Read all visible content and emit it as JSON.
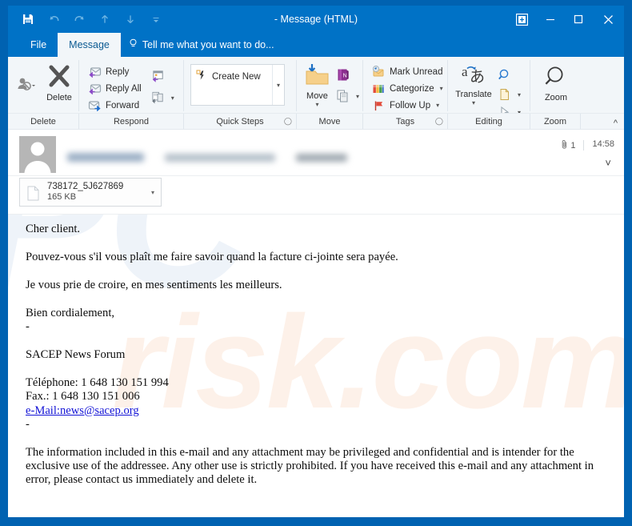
{
  "window": {
    "title": "- Message (HTML)",
    "quick_access": [
      {
        "name": "save-button",
        "label": "Save",
        "enabled": true
      },
      {
        "name": "undo-button",
        "label": "Undo",
        "enabled": false
      },
      {
        "name": "redo-button",
        "label": "Redo",
        "enabled": false
      },
      {
        "name": "previous-item-button",
        "label": "Previous Item",
        "enabled": false
      },
      {
        "name": "next-item-button",
        "label": "Next Item",
        "enabled": false
      },
      {
        "name": "customize-quick-access-toolbar-button",
        "label": "Customize Quick Access Toolbar",
        "enabled": false
      }
    ],
    "controls": {
      "ribbon_display_options": "Ribbon Display Options",
      "minimize": "Minimize",
      "maximize": "Maximize",
      "close": "Close"
    }
  },
  "tabs": {
    "file": "File",
    "message": "Message",
    "tellme": "Tell me what you want to do..."
  },
  "ribbon": {
    "groups": [
      {
        "label": "Delete",
        "launcher": false
      },
      {
        "label": "Respond",
        "launcher": false
      },
      {
        "label": "Quick Steps",
        "launcher": true
      },
      {
        "label": "Move",
        "launcher": false
      },
      {
        "label": "Tags",
        "launcher": true
      },
      {
        "label": "Editing",
        "launcher": false
      },
      {
        "label": "Zoom",
        "launcher": false
      }
    ],
    "delete": {
      "ignore": "Ignore",
      "delete": "Delete"
    },
    "respond": {
      "reply": "Reply",
      "reply_all": "Reply All",
      "forward": "Forward",
      "meeting": "Meeting",
      "more": "More"
    },
    "quick_steps": {
      "create_new": "Create New"
    },
    "move": {
      "move": "Move",
      "onenote": "OneNote",
      "actions": "Actions"
    },
    "tags": {
      "mark_unread": "Mark Unread",
      "categorize": "Categorize",
      "follow_up": "Follow Up"
    },
    "editing": {
      "translate": "Translate",
      "find": "Find",
      "select": "Select"
    },
    "zoom": {
      "zoom": "Zoom"
    },
    "collapse": "Collapse the Ribbon"
  },
  "message_header": {
    "sender_redacted": true,
    "attachment_count": "1",
    "time": "14:58"
  },
  "attachment": {
    "name": "738172_5J627869",
    "size": "165 KB"
  },
  "body": {
    "greeting": "Cher client.",
    "request": "Pouvez-vous s'il vous plaît me faire savoir quand la facture ci-jointe sera payée.",
    "closing_formal": "Je vous prie de croire, en mes sentiments les meilleurs.",
    "closing": "Bien cordialement,",
    "separator_top": "-",
    "signature_org": "SACEP News Forum",
    "phone": "Téléphone: 1 648 130 151 994",
    "fax": "Fax.: 1 648 130 151 006",
    "email_label": "e-Mail:news@sacep.org",
    "separator_bottom": "-",
    "disclaimer": "The information included in this e-mail and any attachment may be privileged and confidential and is intender for the exclusive use of the addressee. Any other use is strictly prohibited. If you have received this e-mail and any attachment in error, please contact us immediately and delete it."
  },
  "watermark": {
    "line1": "PC",
    "line2": "risk.com"
  },
  "colors": {
    "titlebar": "#0072c6",
    "frame": "#0062b1",
    "ribbon_bg": "#f2f6f9",
    "link": "#1414d6"
  }
}
